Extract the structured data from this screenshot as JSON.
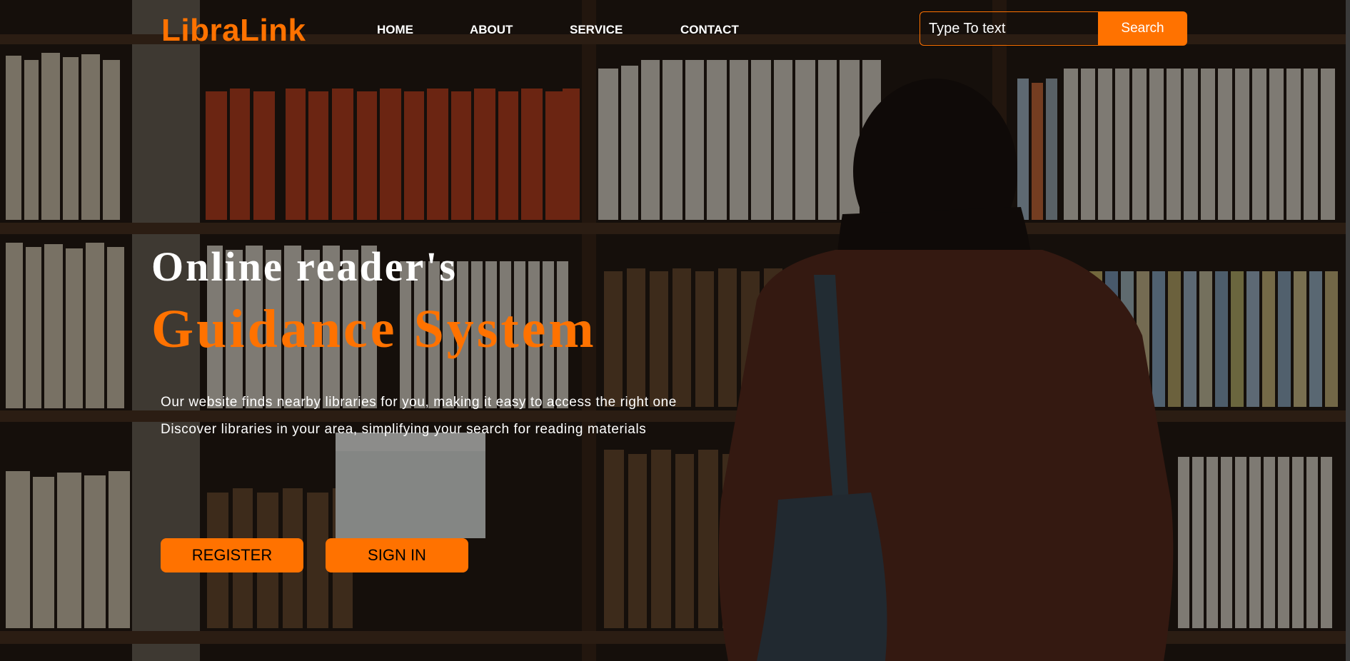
{
  "brand": {
    "logo_text": "LibraLink",
    "accent_color": "#ff7200"
  },
  "nav": {
    "items": [
      {
        "label": "HOME"
      },
      {
        "label": "ABOUT"
      },
      {
        "label": "SERVICE"
      },
      {
        "label": "CONTACT"
      }
    ]
  },
  "search": {
    "placeholder": "Type To text",
    "value": "",
    "button_label": "Search"
  },
  "hero": {
    "heading_line1": "Online reader's",
    "heading_line2": "Guidance System",
    "description_line1": "Our website finds nearby libraries for you, making it easy to access the right one",
    "description_line2": "Discover libraries in your area, simplifying your search for reading materials",
    "register_label": "REGISTER",
    "signin_label": "SIGN IN",
    "background": "library bookshelf with person photo"
  }
}
